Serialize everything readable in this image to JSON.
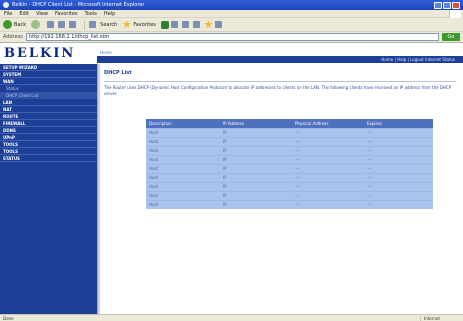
{
  "window": {
    "title": "Belkin - DHCP Client List - Microsoft Internet Explorer"
  },
  "menu": [
    "File",
    "Edit",
    "View",
    "Favorites",
    "Tools",
    "Help"
  ],
  "toolbar": {
    "back": "Back",
    "search": "Search",
    "favorites": "Favorites"
  },
  "address": {
    "label": "Address",
    "url": "http://192.168.2.1/dhcp_list.stm",
    "go": "Go"
  },
  "header": {
    "logo": "BELKIN",
    "home_link": "Home",
    "nav_links": "Home | Help | Logout  Internet Status"
  },
  "sidebar": {
    "items": [
      {
        "label": "SETUP WIZARD",
        "type": "head"
      },
      {
        "label": "SYSTEM",
        "type": "head"
      },
      {
        "label": "WAN",
        "type": "head"
      },
      {
        "label": "Status",
        "type": "sub"
      },
      {
        "label": "DHCP Client List",
        "type": "sub",
        "active": true
      },
      {
        "label": "LAN",
        "type": "head"
      },
      {
        "label": "NAT",
        "type": "head"
      },
      {
        "label": "ROUTE",
        "type": "head"
      },
      {
        "label": "FIREWALL",
        "type": "head"
      },
      {
        "label": "DDNS",
        "type": "head"
      },
      {
        "label": "UPnP",
        "type": "head"
      },
      {
        "label": "TOOLS",
        "type": "head"
      },
      {
        "label": "TOOLS",
        "type": "head"
      },
      {
        "label": "STATUS",
        "type": "head"
      }
    ]
  },
  "content": {
    "title": "DHCP List",
    "description": "The Router uses DHCP (Dynamic Host Configuration Protocol) to allocate IP addresses to clients on the LAN. The following clients have received an IP address from the DHCP server."
  },
  "table": {
    "headers": [
      "Description",
      "IP Address",
      "Physical Address",
      "Expires"
    ],
    "rows": [
      [
        "Host",
        "IP",
        "---",
        "---"
      ],
      [
        "Host",
        "IP",
        "---",
        "---"
      ],
      [
        "Host",
        "IP",
        "---",
        "---"
      ],
      [
        "Host",
        "IP",
        "---",
        "---"
      ],
      [
        "Host",
        "IP",
        "---",
        "---"
      ],
      [
        "Host",
        "IP",
        "---",
        "---"
      ],
      [
        "Host",
        "IP",
        "---",
        "---"
      ],
      [
        "Host",
        "IP",
        "---",
        "---"
      ],
      [
        "Host",
        "IP",
        "---",
        "---"
      ]
    ]
  },
  "status": {
    "left": "Done",
    "zone": "Internet"
  }
}
